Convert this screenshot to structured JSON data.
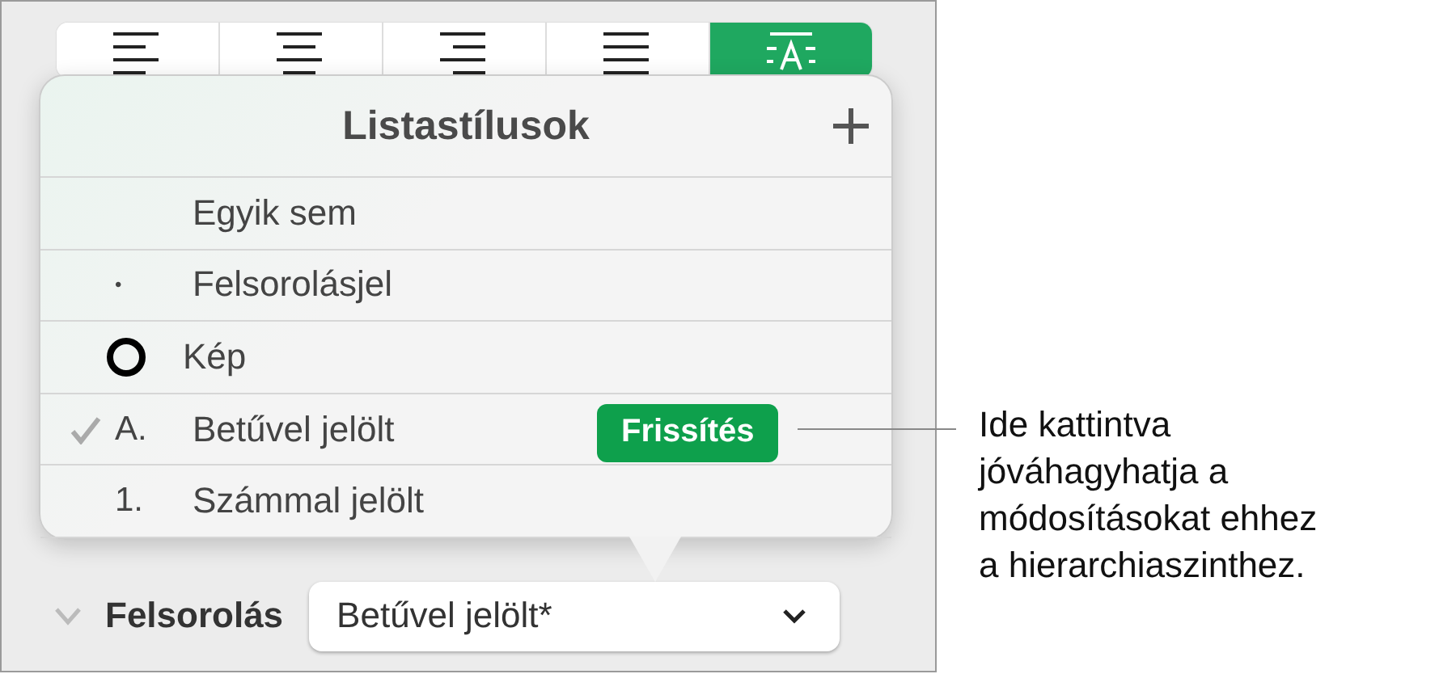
{
  "alignment_buttons": [
    {
      "kind": "left",
      "selected": false
    },
    {
      "kind": "center",
      "selected": false
    },
    {
      "kind": "right",
      "selected": false
    },
    {
      "kind": "justify",
      "selected": false
    },
    {
      "kind": "list",
      "selected": true
    }
  ],
  "popover": {
    "title": "Listastílusok",
    "items": [
      {
        "kind": "none",
        "label": "Egyik sem",
        "checked": false
      },
      {
        "kind": "bullet",
        "marker": "•",
        "label": "Felsorolásjel",
        "checked": false
      },
      {
        "kind": "image",
        "label": "Kép",
        "checked": false
      },
      {
        "kind": "letter",
        "marker": "A.",
        "label": "Betűvel jelölt",
        "checked": true,
        "update_button": "Frissítés"
      },
      {
        "kind": "number",
        "marker": "1.",
        "label": "Számmal jelölt",
        "checked": false
      }
    ]
  },
  "bullets_row": {
    "expanded": false,
    "label": "Felsorolás",
    "value": "Betűvel jelölt*"
  },
  "callout": {
    "lines": [
      "Ide kattintva",
      "jóváhagyhatja a",
      "módosításokat ehhez",
      "a hierarchiaszinthez."
    ]
  }
}
